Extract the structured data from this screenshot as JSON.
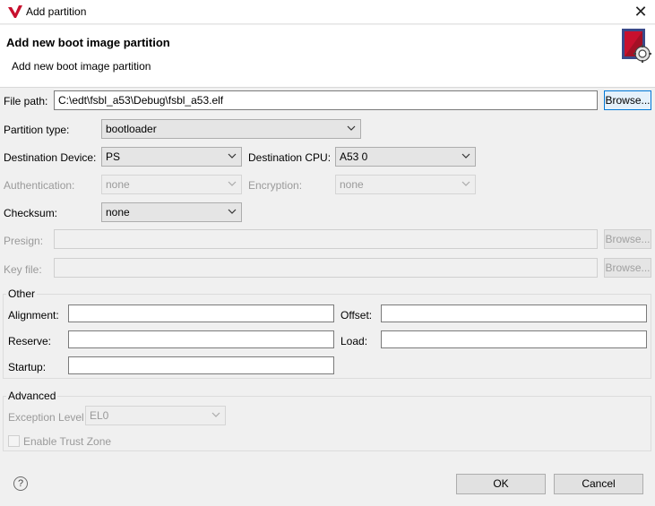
{
  "window": {
    "title": "Add partition",
    "close_glyph": "✕"
  },
  "banner": {
    "title": "Add new boot image partition",
    "subtitle": "Add new boot image partition",
    "icon": "boot-image-settings-icon"
  },
  "file_path": {
    "label": "File path:",
    "value": "C:\\edt\\fsbl_a53\\Debug\\fsbl_a53.elf",
    "browse": "Browse..."
  },
  "partition_type": {
    "label": "Partition type:",
    "value": "bootloader"
  },
  "destination_device": {
    "label": "Destination Device:",
    "value": "PS"
  },
  "destination_cpu": {
    "label": "Destination CPU:",
    "value": "A53 0"
  },
  "authentication": {
    "label": "Authentication:",
    "value": "none"
  },
  "encryption": {
    "label": "Encryption:",
    "value": "none"
  },
  "checksum": {
    "label": "Checksum:",
    "value": "none"
  },
  "presign": {
    "label": "Presign:",
    "value": "",
    "browse": "Browse..."
  },
  "key_file": {
    "label": "Key file:",
    "value": "",
    "browse": "Browse..."
  },
  "other": {
    "title": "Other",
    "alignment_label": "Alignment:",
    "alignment_value": "",
    "offset_label": "Offset:",
    "offset_value": "",
    "reserve_label": "Reserve:",
    "reserve_value": "",
    "load_label": "Load:",
    "load_value": "",
    "startup_label": "Startup:",
    "startup_value": ""
  },
  "advanced": {
    "title": "Advanced",
    "exception_label": "Exception Level",
    "exception_value": "EL0",
    "trustzone_label": "Enable Trust Zone",
    "trustzone_checked": false
  },
  "footer": {
    "help_glyph": "?",
    "ok": "OK",
    "cancel": "Cancel"
  },
  "colors": {
    "accent": "#0078d7",
    "logo_red": "#c8102e"
  }
}
